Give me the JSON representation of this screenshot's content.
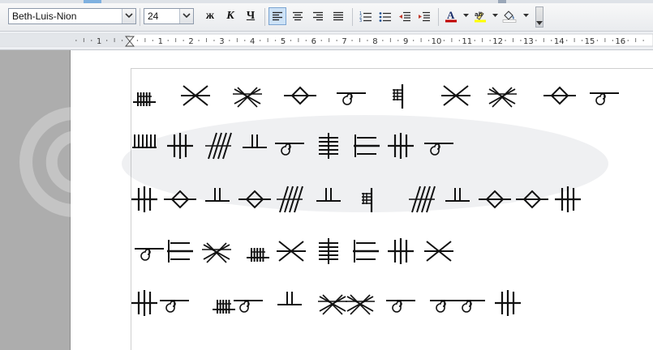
{
  "toolbar": {
    "font_name": "Beth-Luis-Nion",
    "font_size": "24",
    "bold_label": "ж",
    "italic_label": "К",
    "underline_label": "Ч",
    "icons": [
      "align-left-icon",
      "align-center-icon",
      "align-right-icon",
      "justify-icon",
      "numbered-list-icon",
      "bullet-list-icon",
      "decrease-indent-icon",
      "increase-indent-icon",
      "font-color-icon",
      "highlight-icon",
      "background-color-icon"
    ],
    "colors": {
      "font_color": "#c00000",
      "highlight": "#ffff00",
      "active_bg": "#cde2f6"
    }
  },
  "ruler": {
    "numbers": [
      "1",
      "1",
      "2",
      "3",
      "4",
      "5",
      "6",
      "7",
      "8",
      "9",
      "10",
      "11",
      "12",
      "13",
      "14",
      "15",
      "16"
    ]
  },
  "document": {
    "rows": [
      [
        "nion",
        "huath",
        "ruis",
        "quert",
        "straif",
        "coll",
        "huath",
        "ruis",
        "quert",
        "straif"
      ],
      [
        "saille",
        "beith",
        "ngetal",
        "luis",
        "straif",
        "fearn",
        "tinne",
        "beith",
        "straif"
      ],
      [
        "beith",
        "quert",
        "luis",
        "quert",
        "ngetal",
        "luis",
        "coll",
        "ngetal",
        "luis",
        "quert",
        "quert",
        "beith"
      ],
      [
        "straif",
        "tinne",
        "ruis",
        "nion",
        "huath",
        "fearn",
        "tinne",
        "beith",
        "huath"
      ],
      [
        "beith",
        "straif",
        "nion",
        "straif",
        "luis",
        "ruis",
        "ruis",
        "straif",
        "straif",
        "straif",
        "beith"
      ]
    ]
  }
}
